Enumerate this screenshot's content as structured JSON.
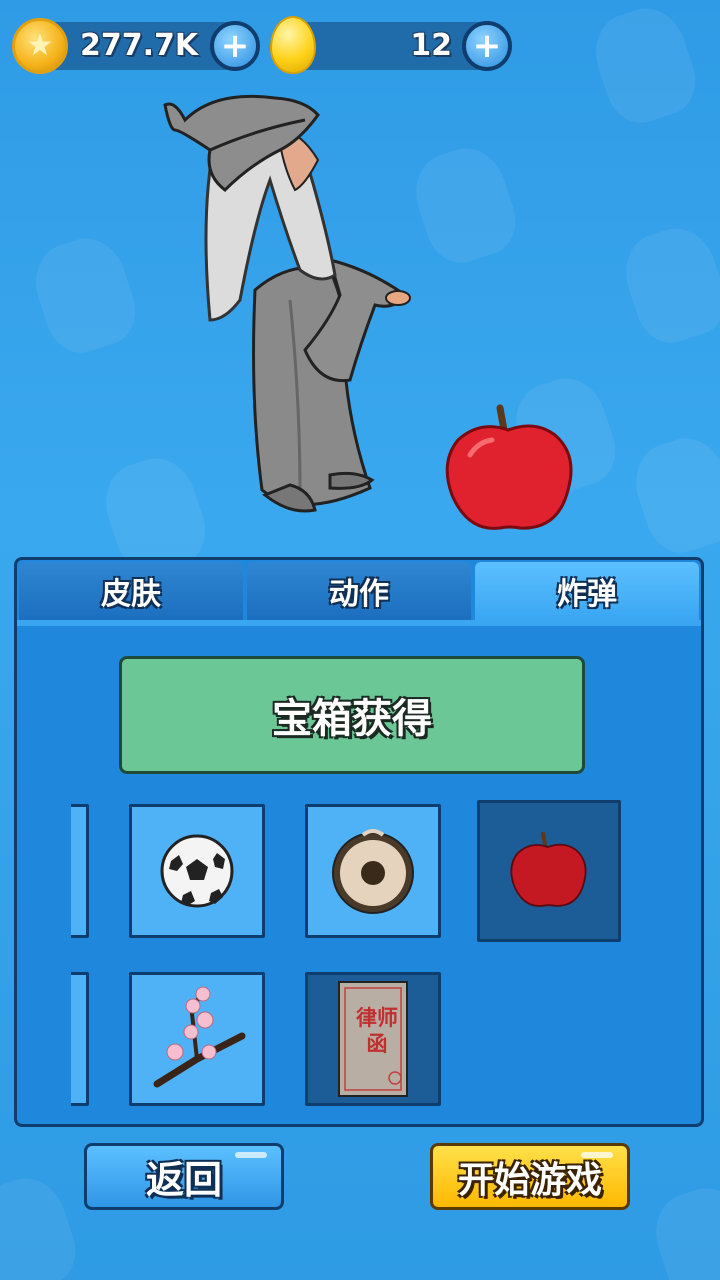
{
  "currency": {
    "coins": {
      "value": "277.7K",
      "icon": "star-coin-icon"
    },
    "eggs": {
      "value": "12",
      "icon": "golden-egg-icon"
    }
  },
  "tabs": [
    {
      "label": "皮肤",
      "active": false
    },
    {
      "label": "动作",
      "active": false
    },
    {
      "label": "炸弹",
      "active": true
    }
  ],
  "banner": {
    "label": "宝箱获得"
  },
  "items": [
    {
      "name": "soccer-ball",
      "selected": false
    },
    {
      "name": "gong",
      "selected": false
    },
    {
      "name": "apple",
      "selected": true
    },
    {
      "name": "cherry-blossom-branch",
      "selected": false
    },
    {
      "name": "lawyer-letter",
      "selected": true,
      "text": "律师函"
    }
  ],
  "buttons": {
    "back": "返回",
    "start": "开始游戏"
  },
  "colors": {
    "panel": "#1f88dc",
    "tab_active": "#3aa6f2",
    "banner": "#6cc797",
    "start_button": "#ffc21a",
    "back_button": "#2f9be6"
  }
}
